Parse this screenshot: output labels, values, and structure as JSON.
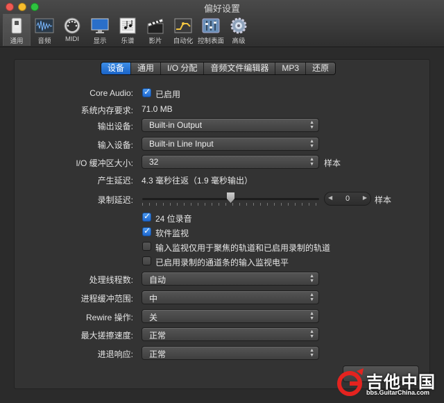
{
  "window": {
    "title": "偏好设置"
  },
  "toolbar": {
    "items": [
      {
        "label": "通用",
        "icon": "general-switch-icon",
        "selected": true
      },
      {
        "label": "音频",
        "icon": "audio-waveform-icon"
      },
      {
        "label": "MIDI",
        "icon": "midi-port-icon"
      },
      {
        "label": "显示",
        "icon": "display-monitor-icon"
      },
      {
        "label": "乐谱",
        "icon": "score-notes-icon"
      },
      {
        "label": "影片",
        "icon": "movie-clapper-icon"
      },
      {
        "label": "自动化",
        "icon": "automation-icon"
      },
      {
        "label": "控制表面",
        "icon": "control-surface-icon"
      },
      {
        "label": "高级",
        "icon": "advanced-gear-icon"
      }
    ]
  },
  "tabs": [
    {
      "label": "设备",
      "active": true
    },
    {
      "label": "通用"
    },
    {
      "label": "I/O 分配"
    },
    {
      "label": "音频文件编辑器"
    },
    {
      "label": "MP3"
    },
    {
      "label": "还原"
    }
  ],
  "settings": {
    "core_audio": {
      "label": "Core Audio:",
      "check_label": "已启用",
      "checked": true
    },
    "memory": {
      "label": "系统内存要求:",
      "value": "71.0 MB"
    },
    "output_device": {
      "label": "输出设备:",
      "value": "Built-in Output"
    },
    "input_device": {
      "label": "输入设备:",
      "value": "Built-in Line Input"
    },
    "io_buffer": {
      "label": "I/O 缓冲区大小:",
      "value": "32",
      "suffix": "样本"
    },
    "latency": {
      "label": "产生延迟:",
      "value": "4.3 毫秒往返（1.9 毫秒输出）"
    },
    "record_delay": {
      "label": "录制延迟:",
      "value": "0",
      "suffix": "样本",
      "slider_position": 0.5
    },
    "checks": [
      {
        "label": "24 位录音",
        "checked": true
      },
      {
        "label": "软件监视",
        "checked": true
      },
      {
        "label": "输入监视仅用于聚焦的轨道和已启用录制的轨道",
        "checked": false
      },
      {
        "label": "已启用录制的通道条的输入监视电平",
        "checked": false
      }
    ],
    "threads": {
      "label": "处理线程数:",
      "value": "自动"
    },
    "process_buffer": {
      "label": "进程缓冲范围:",
      "value": "中"
    },
    "rewire": {
      "label": "Rewire 操作:",
      "value": "关"
    },
    "max_scrub": {
      "label": "最大搓擦速度:",
      "value": "正常"
    },
    "scrub_response": {
      "label": "进退响应:",
      "value": "正常"
    }
  },
  "watermark": {
    "text": "吉他中国",
    "url": "bbs.GuitarChina.com"
  },
  "colors": {
    "accent": "#1f68cf",
    "background": "#333333",
    "titlebar": "#3c3c3c"
  }
}
